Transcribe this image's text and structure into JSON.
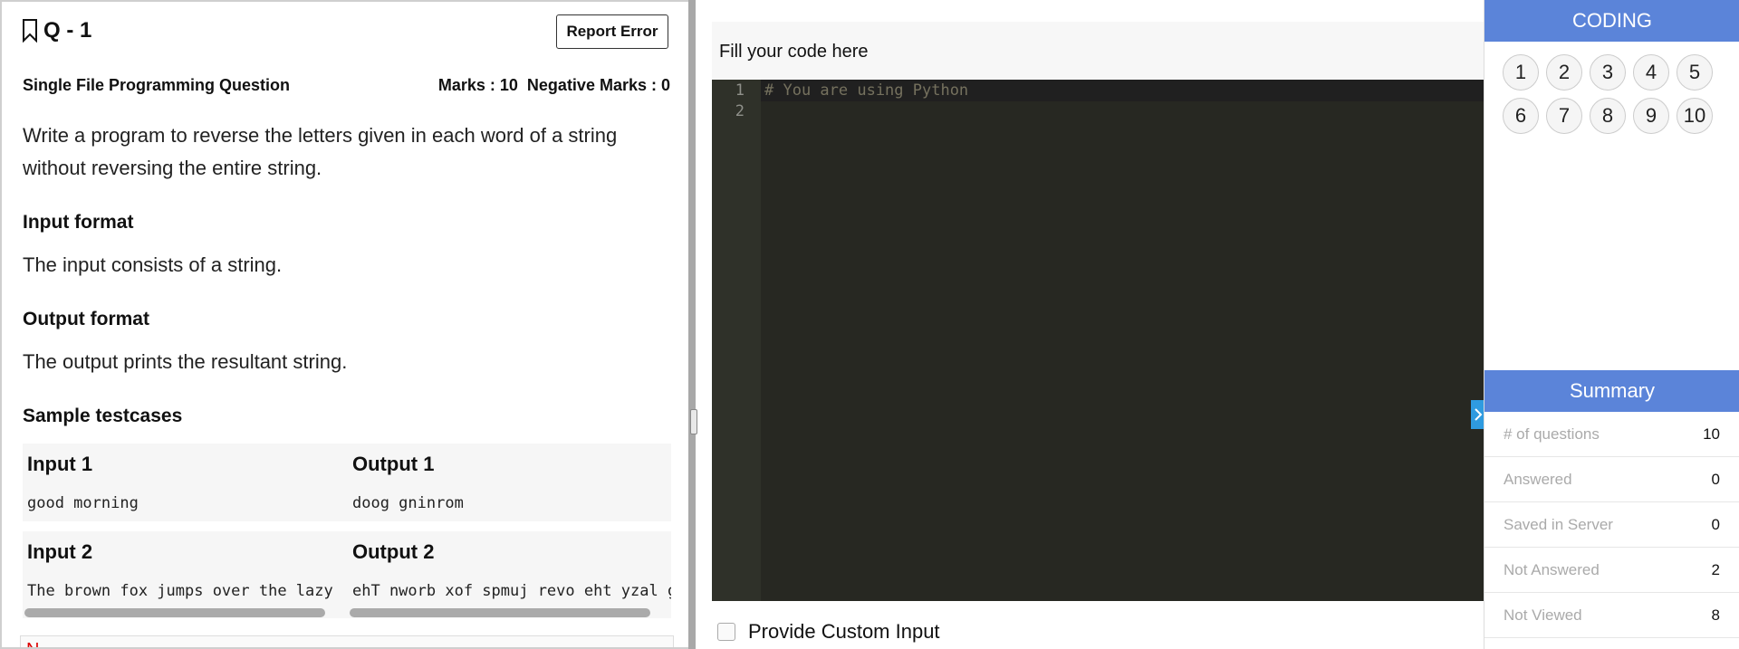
{
  "question": {
    "number_label": "Q - 1",
    "report_label": "Report Error",
    "type": "Single File Programming Question",
    "marks_text": "Marks : 10  Negative Marks : 0",
    "description": "Write a program to reverse the letters given in each word of a string without reversing the entire string.",
    "input_format_title": "Input format",
    "input_format_text": "The input consists of a string.",
    "output_format_title": "Output format",
    "output_format_text": "The output prints the resultant string.",
    "sample_title": "Sample testcases",
    "testcases": [
      {
        "input_label": "Input 1",
        "input": "good morning",
        "output_label": "Output 1",
        "output": "doog gninrom"
      },
      {
        "input_label": "Input 2",
        "input": "The brown fox jumps over the lazy dog",
        "output_label": "Output 2",
        "output": "ehT nworb xof spmuj revo eht yzal god"
      }
    ],
    "tail_text": "N"
  },
  "editor": {
    "fill_label": "Fill your code here",
    "line_numbers": [
      "1",
      "2"
    ],
    "code_line_1": "# You are using Python",
    "custom_input_label": "Provide Custom Input"
  },
  "sidebar": {
    "section_title": "CODING",
    "question_numbers": [
      "1",
      "2",
      "3",
      "4",
      "5",
      "6",
      "7",
      "8",
      "9",
      "10"
    ],
    "summary_title": "Summary",
    "summary": [
      {
        "label": "# of questions",
        "value": "10"
      },
      {
        "label": "Answered",
        "value": "0"
      },
      {
        "label": "Saved in Server",
        "value": "0"
      },
      {
        "label": "Not Answered",
        "value": "2"
      },
      {
        "label": "Not Viewed",
        "value": "8"
      }
    ],
    "toggle_icon": "chevron-right-icon"
  },
  "colors": {
    "accent": "#5b84d9",
    "editor_bg": "#272822",
    "toggle": "#2f9be0"
  }
}
